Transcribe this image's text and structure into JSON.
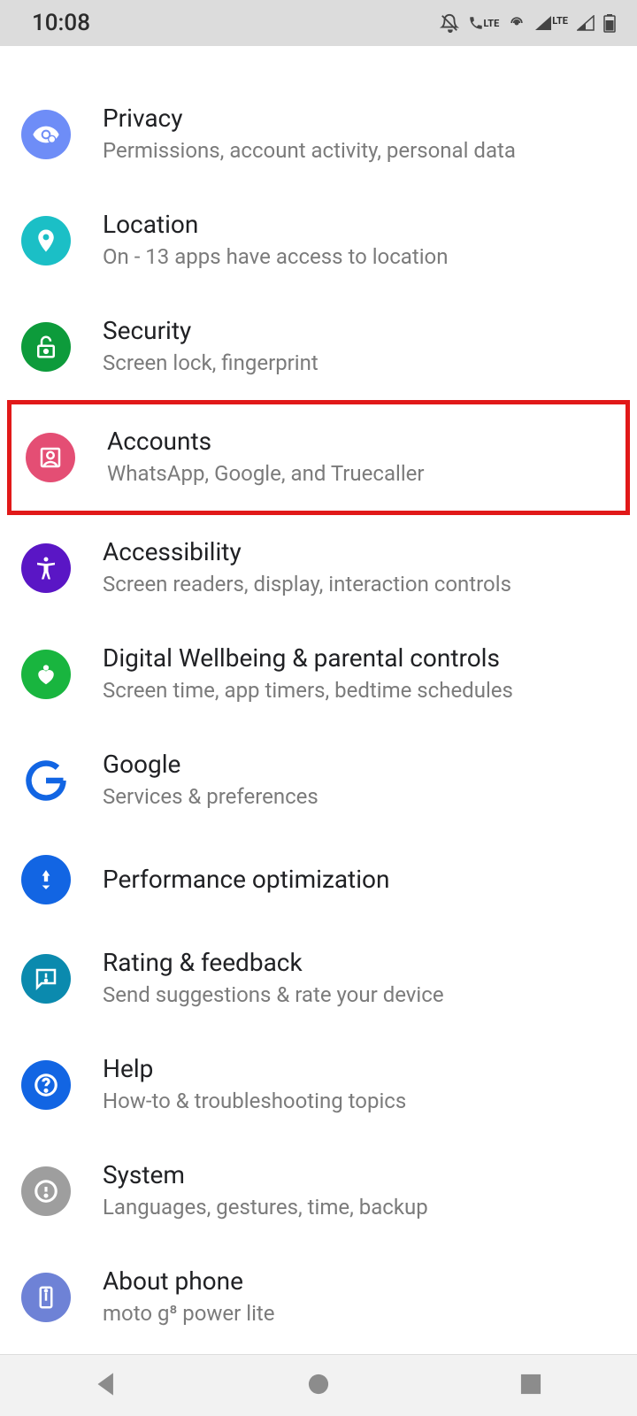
{
  "statusBar": {
    "time": "10:08",
    "lteLabel1": "LTE",
    "lteLabel2": "LTE"
  },
  "items": {
    "privacy": {
      "title": "Privacy",
      "subtitle": "Permissions, account activity, personal data",
      "iconColor": "#6e8df7"
    },
    "location": {
      "title": "Location",
      "subtitle": "On - 13 apps have access to location",
      "iconColor": "#1bbfc6"
    },
    "security": {
      "title": "Security",
      "subtitle": "Screen lock, fingerprint",
      "iconColor": "#0d9b3b"
    },
    "accounts": {
      "title": "Accounts",
      "subtitle": "WhatsApp, Google, and Truecaller",
      "iconColor": "#e44e74"
    },
    "accessibility": {
      "title": "Accessibility",
      "subtitle": "Screen readers, display, interaction controls",
      "iconColor": "#5a16c5"
    },
    "wellbeing": {
      "title": "Digital Wellbeing & parental controls",
      "subtitle": "Screen time, app timers, bedtime schedules",
      "iconColor": "#19b53f"
    },
    "google": {
      "title": "Google",
      "subtitle": "Services & preferences",
      "iconColor": "#ffffff"
    },
    "performance": {
      "title": "Performance optimization",
      "subtitle": "",
      "iconColor": "#1265e3"
    },
    "rating": {
      "title": "Rating & feedback",
      "subtitle": "Send suggestions & rate your device",
      "iconColor": "#0b8aae"
    },
    "help": {
      "title": "Help",
      "subtitle": "How-to & troubleshooting topics",
      "iconColor": "#1265e3"
    },
    "system": {
      "title": "System",
      "subtitle": "Languages, gestures, time, backup",
      "iconColor": "#9e9e9e"
    },
    "about": {
      "title": "About phone",
      "subtitle": "moto g⁸ power lite",
      "iconColor": "#6e82d6"
    }
  }
}
